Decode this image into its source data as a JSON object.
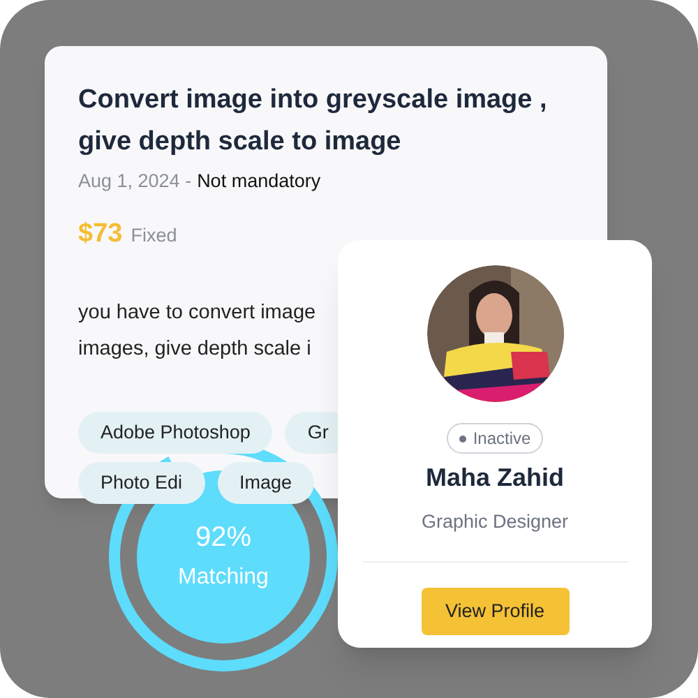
{
  "job": {
    "title": "Convert image into greyscale image , give depth scale to image",
    "date": "Aug 1, 2024 -",
    "requirement": "Not mandatory",
    "price": "$73",
    "price_type": "Fixed",
    "description_lines": [
      "you have to convert image",
      "images, give depth scale i"
    ],
    "tags": [
      "Adobe Photoshop",
      "Gr",
      "Photo Edi",
      "Image"
    ]
  },
  "profile": {
    "status": "Inactive",
    "name": "Maha Zahid",
    "role": "Graphic Designer",
    "button": "View Profile"
  },
  "match": {
    "percent": "92%",
    "label": "Matching"
  }
}
